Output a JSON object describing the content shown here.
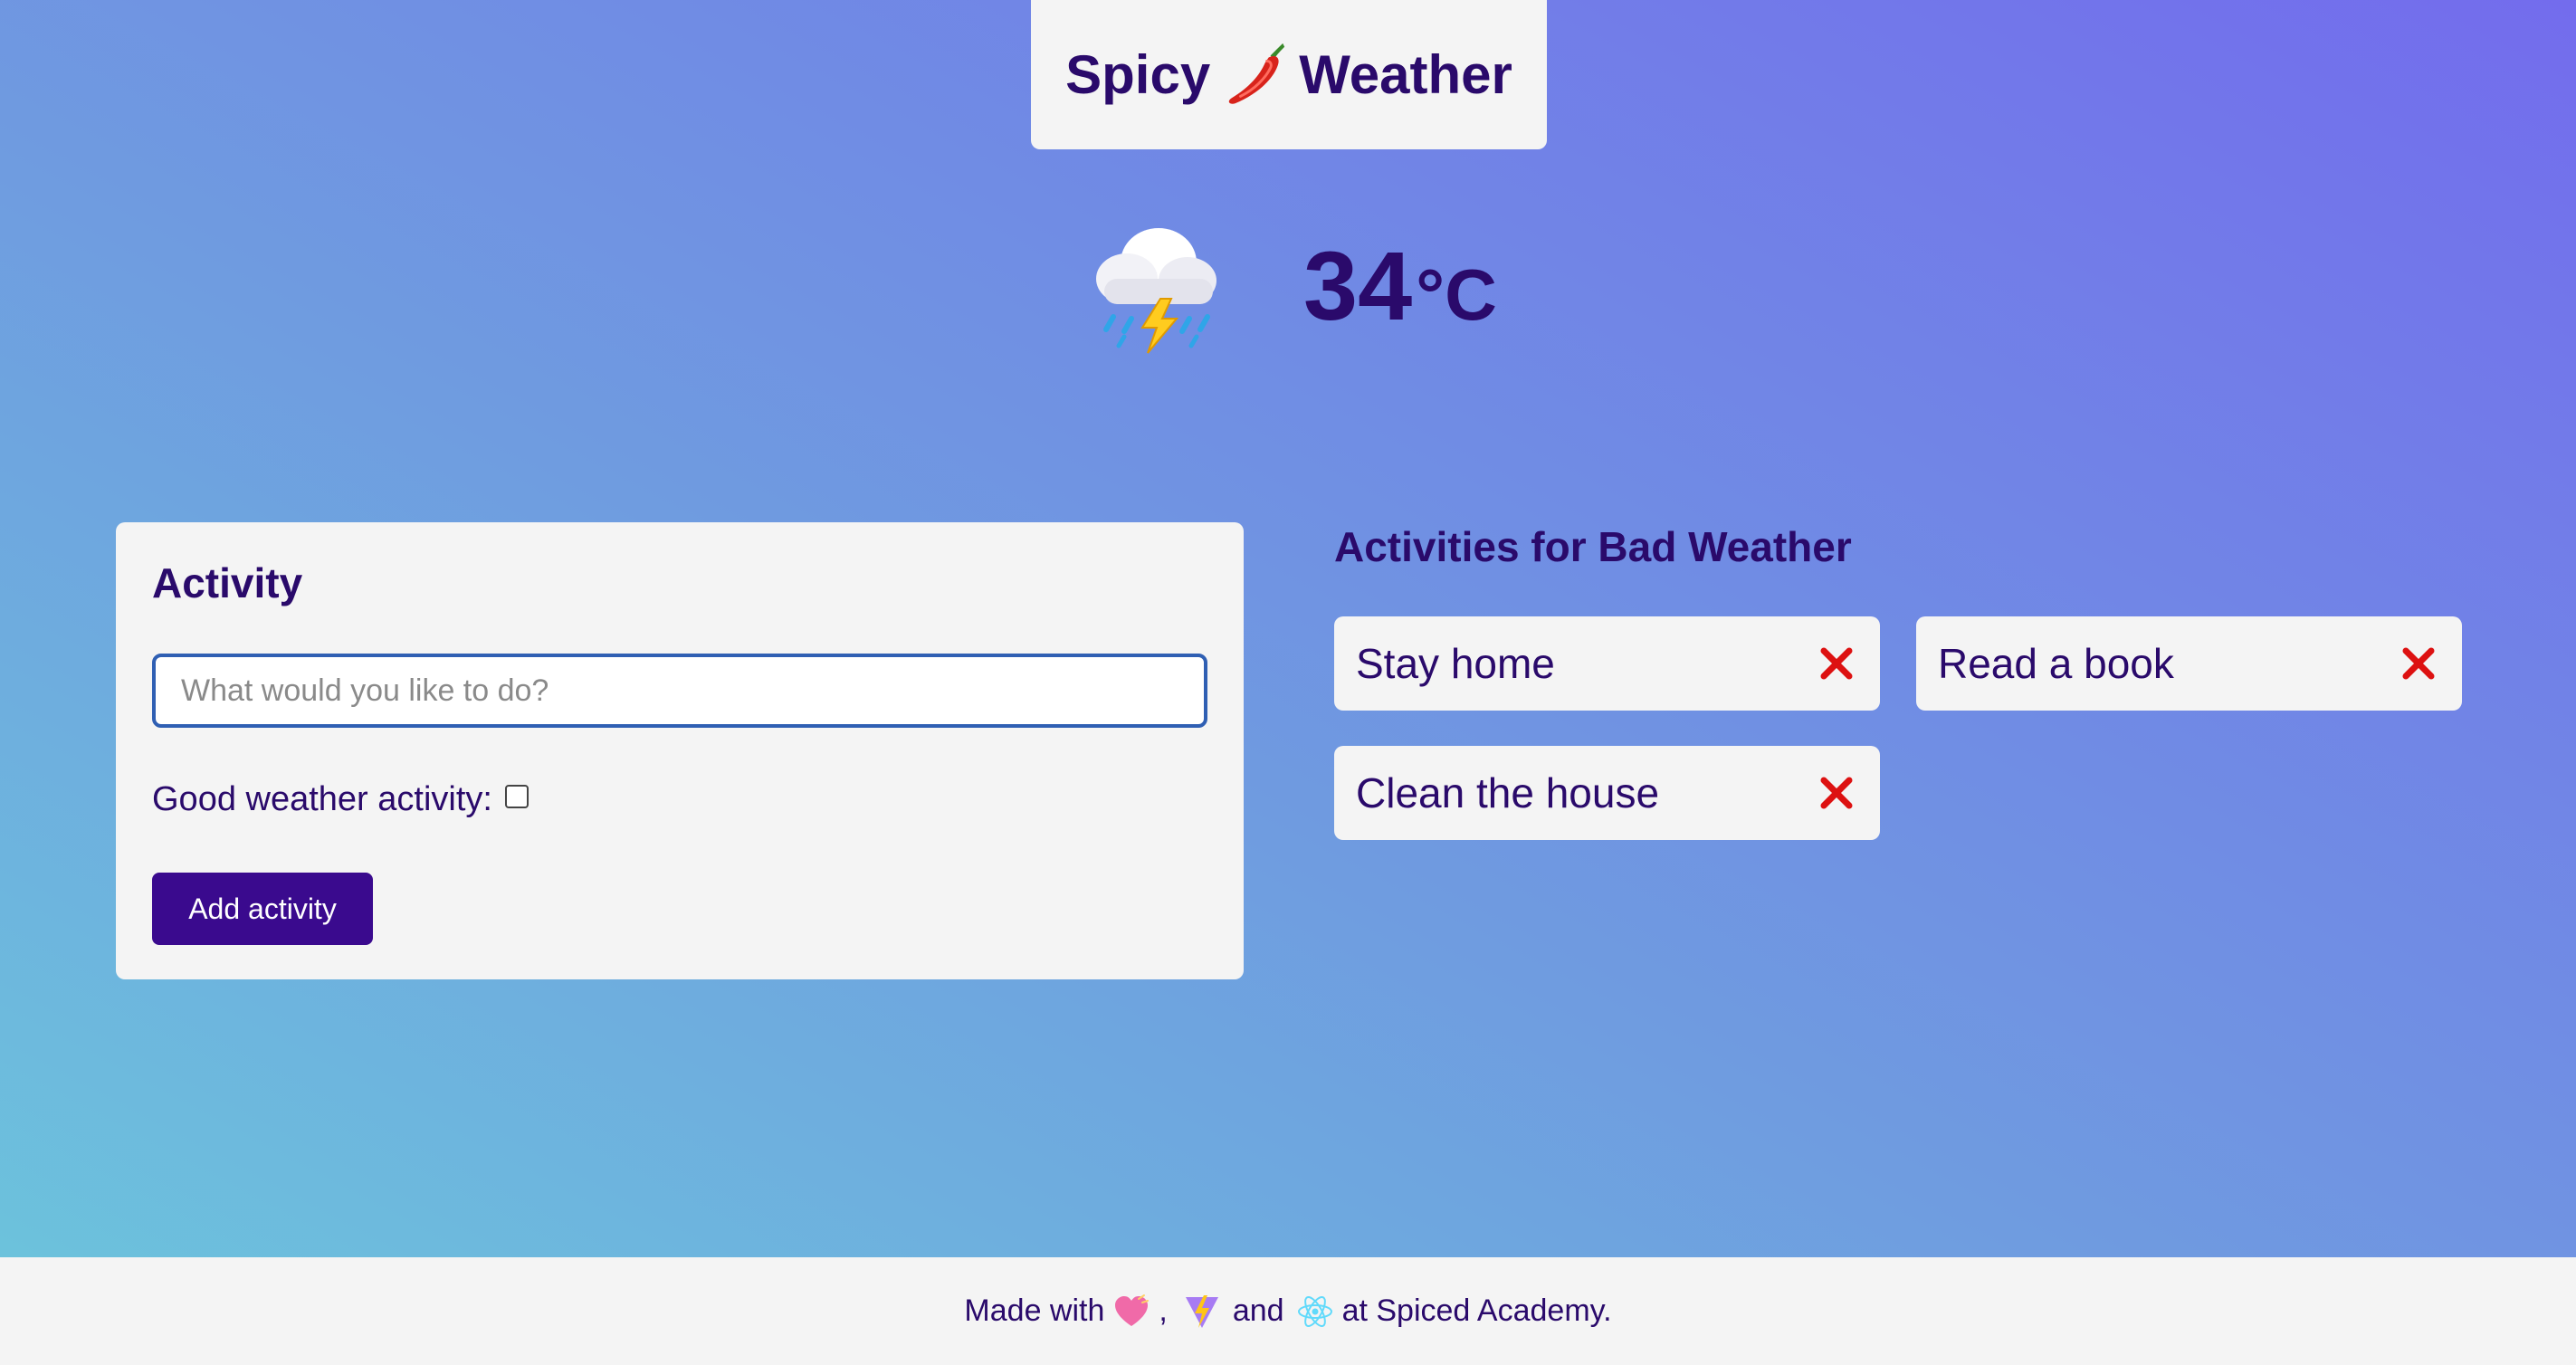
{
  "header": {
    "title_left": "Spicy",
    "title_right": "Weather",
    "icon": "chili-pepper-icon"
  },
  "weather": {
    "icon": "thunderstorm-cloud-icon",
    "temperature": "34",
    "unit": "°C"
  },
  "form": {
    "title": "Activity",
    "input_placeholder": "What would you like to do?",
    "input_value": "",
    "good_weather_label": "Good weather activity:",
    "good_weather_checked": false,
    "submit_label": "Add activity"
  },
  "list": {
    "title": "Activities for Bad Weather",
    "items": [
      {
        "label": "Stay home"
      },
      {
        "label": "Read a book"
      },
      {
        "label": "Clean the house"
      }
    ]
  },
  "footer": {
    "text_before": "Made with",
    "comma": ",",
    "and": "and",
    "text_after": "at Spiced Academy.",
    "icons": [
      "heart-icon",
      "vite-icon",
      "react-icon"
    ]
  },
  "colors": {
    "text_primary": "#2a0a6b",
    "button_bg": "#3a0a8e",
    "card_bg": "#f4f4f4",
    "delete_red": "#dd1111",
    "input_border": "#2f5fb3"
  }
}
